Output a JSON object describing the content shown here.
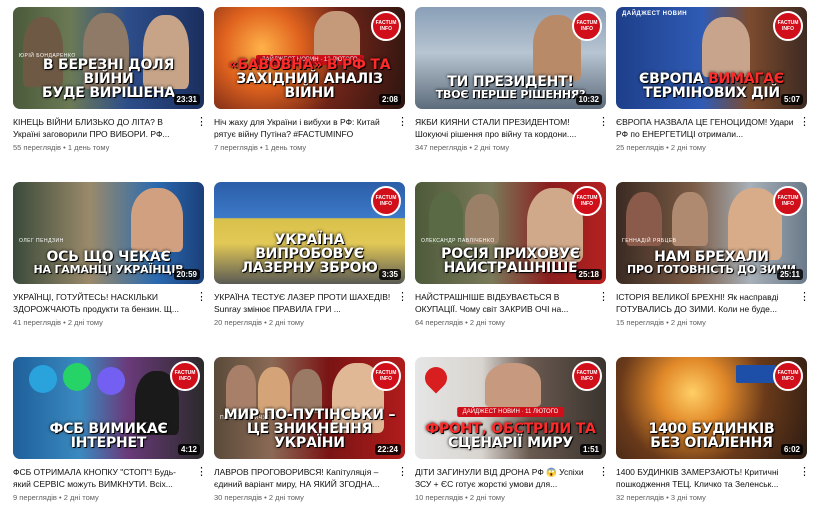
{
  "videos": [
    {
      "headline_pre": "В березні доля війни",
      "headline_accent": "",
      "headline_post": "буде вирішена",
      "sub": "",
      "duration": "23:31",
      "title": "КІНЕЦЬ ВІЙНИ БЛИЗЬКО ДО ЛІТА? В Україні заговорили ПРО ВИБОРИ. РФ...",
      "views": "55 переглядів",
      "age": "1 день тому",
      "logo": "FACTUM INFO",
      "tag": "ЮРІЙ БОНДАРЕНКО",
      "digest": ""
    },
    {
      "headline_pre": "",
      "headline_accent": "«Бавовна» в РФ та",
      "headline_post": "західний аналіз війни",
      "sub": "",
      "duration": "2:08",
      "title": "Ніч жаху для України і вибухи в РФ: Китай рятує війну Путіна? #FACTUMINFO",
      "views": "7 переглядів",
      "age": "1 день тому",
      "logo": "FACTUM INFO",
      "tag": "",
      "digest": "ДАЙДЖЕСТ НОВИН · 12 ЛЮТОГО"
    },
    {
      "headline_pre": "Ти президент!",
      "headline_accent": "",
      "headline_post": "",
      "sub": "твоє перше рішення?",
      "duration": "10:32",
      "title": "ЯКБИ КИЯНИ СТАЛИ ПРЕЗИДЕНТОМ! Шокуючі рішення про війну та кордони....",
      "views": "347 переглядів",
      "age": "2 дні тому",
      "logo": "FACTUM INFO",
      "tag": "",
      "digest": ""
    },
    {
      "headline_pre": "Європа",
      "headline_accent": "вимагає",
      "headline_post": "термінових дій",
      "sub": "",
      "duration": "5:07",
      "title": "ЄВРОПА НАЗВАЛА ЦЕ ГЕНОЦИДОМ! Удари РФ по ЕНЕРГЕТИЦІ отримали...",
      "views": "25 переглядів",
      "age": "2 дні тому",
      "logo": "FACTUM INFO",
      "tag": "ДАЙДЖЕСТ НОВИН",
      "digest": ""
    },
    {
      "headline_pre": "Ось що чекає",
      "headline_accent": "",
      "headline_post": "",
      "sub": "на гаманці українців",
      "duration": "20:59",
      "title": "УКРАЇНЦІ, ГОТУЙТЕСЬ! НАСКІЛЬКИ ЗДОРОЖЧАЮТЬ продукти та бензин. Щ...",
      "views": "41 переглядів",
      "age": "2 дні тому",
      "logo": "",
      "tag": "ОЛЕГ ПЕНДЗИН",
      "digest": ""
    },
    {
      "headline_pre": "Україна випробовує",
      "headline_accent": "",
      "headline_post": "лазерну зброю",
      "sub": "",
      "duration": "3:35",
      "title": "УКРАЇНА ТЕСТУЄ ЛАЗЕР ПРОТИ ШАХЕДІВ! Sunray змінює ПРАВИЛА ГРИ ...",
      "views": "20 переглядів",
      "age": "2 дні тому",
      "logo": "FACTUM INFO",
      "tag": "",
      "digest": ""
    },
    {
      "headline_pre": "Росія",
      "headline_accent": "",
      "headline_post": "приховує найстрашніше",
      "sub": "",
      "duration": "25:18",
      "title": "НАЙСТРАШНІШЕ ВІДБУВАЄТЬСЯ В ОКУПАЦІЇ. Чому світ ЗАКРИВ ОЧІ на...",
      "views": "64 переглядів",
      "age": "2 дні тому",
      "logo": "FACTUM INFO",
      "tag": "ОЛЕКСАНДР ПАВЛІЧЕНКО",
      "digest": ""
    },
    {
      "headline_pre": "Нам брехали",
      "headline_accent": "",
      "headline_post": "",
      "sub": "про готовність до зими",
      "duration": "25:11",
      "title": "ІСТОРІЯ ВЕЛИКОЇ БРЕХНІ! Як насправді ГОТУВАЛИСЬ ДО ЗИМИ. Коли не буде...",
      "views": "15 переглядів",
      "age": "2 дні тому",
      "logo": "FACTUM INFO",
      "tag": "ГЕННАДІЙ РЯБЦЕВ",
      "digest": ""
    },
    {
      "headline_pre": "ФСБ вимикає",
      "headline_accent": "",
      "headline_post": "інтернет",
      "sub": "",
      "duration": "4:12",
      "title": "ФСБ ОТРИМАЛА КНОПКУ \"СТОП\"! Будь-який СЕРВІС можуть ВИМКНУТИ. Всіх...",
      "views": "9 переглядів",
      "age": "2 дні тому",
      "logo": "FACTUM INFO",
      "tag": "",
      "digest": ""
    },
    {
      "headline_pre": "Мир по-путінськи –",
      "headline_accent": "",
      "headline_post": "це зникнення України",
      "sub": "",
      "duration": "22:24",
      "title": "ЛАВРОВ ПРОГОВОРИВСЯ! Капітуляція – єдиний варіант миру, НА ЯКИЙ ЗГОДНА...",
      "views": "30 переглядів",
      "age": "2 дні тому",
      "logo": "FACTUM INFO",
      "tag": "ПАВЛО ЛАКІЙЧУК",
      "digest": ""
    },
    {
      "headline_pre": "",
      "headline_accent": "Фронт, обстріли та",
      "headline_post": "сценарії миру",
      "sub": "",
      "duration": "1:51",
      "title": "ДІТИ ЗАГИНУЛИ ВІД ДРОНА РФ 😱 Успіхи ЗСУ + ЄС готує жорсткі умови для...",
      "views": "10 переглядів",
      "age": "2 дні тому",
      "logo": "FACTUM INFO",
      "tag": "",
      "digest": "ДАЙДЖЕСТ НОВИН · 11 ЛЮТОГО"
    },
    {
      "headline_pre": "1400 будинків",
      "headline_accent": "",
      "headline_post": "без опалення",
      "sub": "",
      "duration": "6:02",
      "title": "1400 БУДИНКІВ ЗАМЕРЗАЮТЬ! Критичні пошкодження ТЕЦ. Кличко та Зеленськ...",
      "views": "32 переглядів",
      "age": "3 дні тому",
      "logo": "FACTUM INFO",
      "tag": "",
      "digest": ""
    }
  ],
  "separator": "•",
  "more_icon": "⋮"
}
